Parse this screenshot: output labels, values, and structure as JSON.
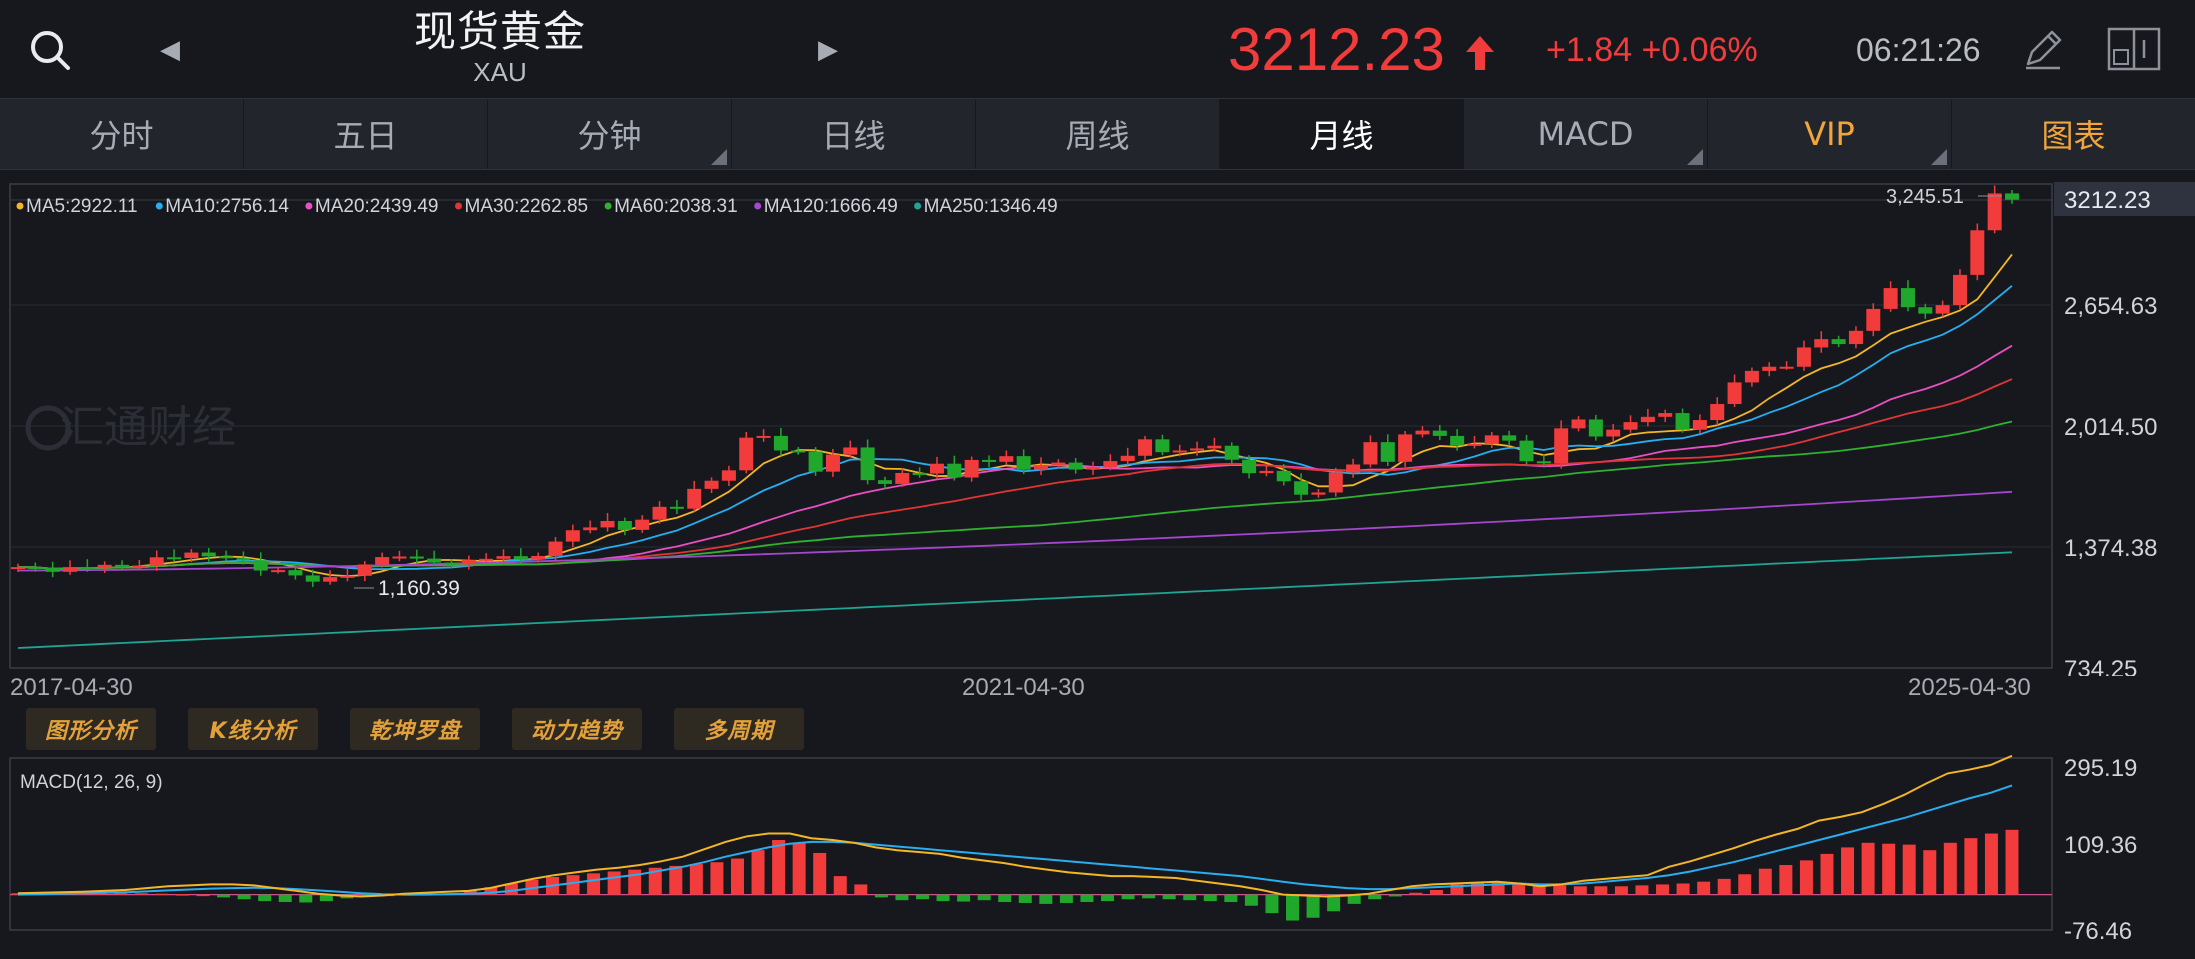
{
  "header": {
    "title": "现货黄金",
    "code": "XAU",
    "price": "3212.23",
    "change": "+1.84 +0.06%",
    "time": "06:21:26",
    "icons": [
      "search-icon",
      "prev-arrow-icon",
      "next-arrow-icon",
      "up-arrow-icon",
      "pen-icon",
      "layout-icon"
    ],
    "colors": {
      "up": "#f23b3b",
      "down": "#1fa82c",
      "gold": "#f1a53b"
    }
  },
  "tabs": [
    {
      "label": "分时",
      "corner": false
    },
    {
      "label": "五日",
      "corner": false
    },
    {
      "label": "分钟",
      "corner": true
    },
    {
      "label": "日线",
      "corner": false
    },
    {
      "label": "周线",
      "corner": false
    },
    {
      "label": "月线",
      "corner": false,
      "active": true
    },
    {
      "label": "MACD",
      "corner": true
    },
    {
      "label": "VIP",
      "corner": true,
      "gold": true
    },
    {
      "label": "图表",
      "corner": false,
      "gold": true
    }
  ],
  "tools": [
    "图形分析",
    "K线分析",
    "乾坤罗盘",
    "动力趋势",
    "多周期"
  ],
  "watermark": "汇通财经",
  "dates": [
    "2017-04-30",
    "2021-04-30",
    "2025-04-30"
  ],
  "chart_data": [
    {
      "type": "candlestick",
      "title": "",
      "ma_legend": [
        {
          "label": "MA5:2922.11",
          "color": "#f3b626"
        },
        {
          "label": "MA10:2756.14",
          "color": "#27aef0"
        },
        {
          "label": "MA20:2439.49",
          "color": "#e84fc2"
        },
        {
          "label": "MA30:2262.85",
          "color": "#e03535"
        },
        {
          "label": "MA60:2038.31",
          "color": "#2fb12f"
        },
        {
          "label": "MA120:1666.49",
          "color": "#a546cf"
        },
        {
          "label": "MA250:1346.49",
          "color": "#1fa593"
        }
      ],
      "y_ticks": [
        "3212.23",
        "2,654.63",
        "2,014.50",
        "1,374.38",
        "734.25"
      ],
      "y_range": [
        734.25,
        3294.77
      ],
      "high_label": "3,245.51",
      "low_label": "1,160.39",
      "current_price_label": "3212.23",
      "x_labels": [
        "2017-04-30",
        "2021-04-30",
        "2025-04-30"
      ],
      "ohlc_close": [
        1268,
        1266,
        1243,
        1268,
        1265,
        1280,
        1272,
        1276,
        1320,
        1316,
        1345,
        1325,
        1315,
        1304,
        1250,
        1252,
        1224,
        1191,
        1215,
        1222,
        1282,
        1321,
        1324,
        1313,
        1292,
        1283,
        1305,
        1312,
        1326,
        1308,
        1327,
        1403,
        1463,
        1478,
        1512,
        1465,
        1519,
        1587,
        1577,
        1682,
        1725,
        1780,
        1953,
        1962,
        1885,
        1879,
        1773,
        1863,
        1901,
        1728,
        1708,
        1766,
        1763,
        1815,
        1742,
        1835,
        1825,
        1855,
        1783,
        1807,
        1821,
        1784,
        1796,
        1829,
        1857,
        1944,
        1876,
        1885,
        1896,
        1910,
        1836,
        1765,
        1777,
        1722,
        1651,
        1663,
        1769,
        1811,
        1929,
        1825,
        1970,
        1990,
        1962,
        1912,
        1920,
        1965,
        1937,
        1828,
        1817,
        2002,
        2049,
        1959,
        1995,
        2035,
        2063,
        2083,
        1995,
        2046,
        2131,
        2245,
        2306,
        2328,
        2328,
        2430,
        2474,
        2448,
        2518,
        2634,
        2744,
        2643,
        2609,
        2654,
        2814,
        3050,
        3245,
        3212
      ],
      "ma_end_values": {
        "MA5": 2922.11,
        "MA10": 2756.14,
        "MA20": 2439.49,
        "MA30": 2262.85,
        "MA60": 2038.31,
        "MA120": 1666.49,
        "MA250": 1346.49
      }
    },
    {
      "type": "bar",
      "title": "MACD(12, 26, 9)",
      "y_ticks": [
        "295.19",
        "109.36",
        "-76.46"
      ],
      "y_range": [
        -76.46,
        295.19
      ],
      "histogram": [
        3,
        3,
        4,
        5,
        4,
        3,
        3,
        2,
        1,
        0,
        -6,
        -10,
        -14,
        -16,
        -17,
        -14,
        -8,
        -3,
        0,
        1,
        2,
        3,
        8,
        16,
        24,
        32,
        38,
        42,
        46,
        50,
        54,
        58,
        62,
        66,
        70,
        78,
        96,
        118,
        112,
        90,
        40,
        22,
        -6,
        -12,
        -10,
        -14,
        -15,
        -12,
        -16,
        -18,
        -20,
        -18,
        -16,
        -14,
        -10,
        -8,
        -10,
        -12,
        -14,
        -16,
        -24,
        -40,
        -56,
        -50,
        -36,
        -20,
        -10,
        -4,
        4,
        10,
        22,
        26,
        26,
        24,
        22,
        20,
        18,
        18,
        18,
        20,
        22,
        24,
        28,
        34,
        44,
        56,
        64,
        74,
        88,
        102,
        112,
        110,
        108,
        96,
        112,
        122,
        132,
        140
      ],
      "macd_line": [
        3,
        4,
        5,
        6,
        8,
        10,
        14,
        18,
        20,
        22,
        22,
        20,
        14,
        8,
        2,
        -2,
        -4,
        -2,
        2,
        4,
        6,
        8,
        14,
        24,
        34,
        42,
        48,
        54,
        58,
        64,
        72,
        82,
        98,
        114,
        126,
        132,
        132,
        122,
        118,
        112,
        102,
        96,
        92,
        88,
        80,
        74,
        68,
        60,
        54,
        48,
        44,
        40,
        40,
        38,
        36,
        30,
        24,
        18,
        10,
        0,
        -2,
        -4,
        -2,
        2,
        10,
        18,
        22,
        24,
        26,
        28,
        24,
        18,
        22,
        30,
        34,
        38,
        42,
        60,
        72,
        86,
        100,
        116,
        130,
        142,
        160,
        168,
        178,
        196,
        216,
        240,
        262,
        270,
        280,
        300
      ],
      "signal_line": [
        0,
        1,
        2,
        3,
        4,
        5,
        7,
        9,
        11,
        13,
        14,
        15,
        14,
        12,
        9,
        6,
        3,
        1,
        0,
        0,
        1,
        2,
        4,
        8,
        14,
        20,
        26,
        32,
        38,
        44,
        52,
        60,
        70,
        82,
        92,
        102,
        110,
        114,
        114,
        112,
        108,
        104,
        100,
        96,
        92,
        88,
        84,
        80,
        76,
        72,
        68,
        64,
        60,
        56,
        52,
        48,
        44,
        40,
        34,
        28,
        22,
        18,
        14,
        12,
        12,
        14,
        16,
        18,
        20,
        22,
        24,
        22,
        22,
        24,
        28,
        32,
        36,
        42,
        50,
        60,
        70,
        82,
        94,
        106,
        118,
        130,
        142,
        154,
        166,
        180,
        194,
        208,
        220,
        236
      ]
    }
  ]
}
